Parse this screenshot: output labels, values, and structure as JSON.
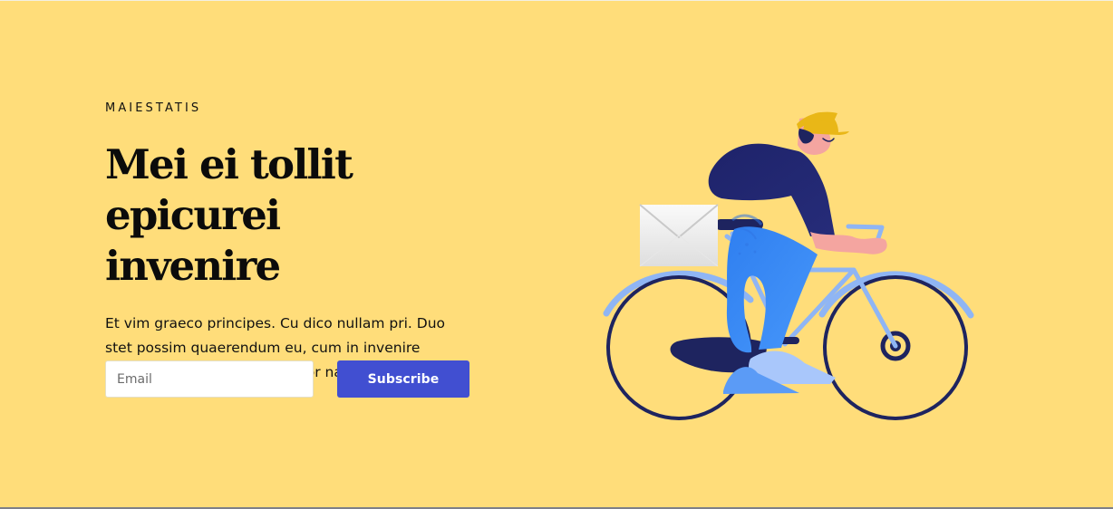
{
  "hero": {
    "eyebrow": "MAIESTATIS",
    "headline_line_1": "Mei ei tollit",
    "headline_line_2": "epicurei invenire",
    "description": "Et vim graeco principes. Cu dico nullam pri. Duo stet possim quaerendum eu, cum in invenire platonem. An animal assentior nam."
  },
  "subscribe_form": {
    "email_placeholder": "Email",
    "email_value": "",
    "button_label": "Subscribe"
  },
  "illustration": {
    "name": "courier-riding-bicycle-illustration",
    "icon_names": [
      "mail-envelope-icon",
      "bicycle-icon",
      "courier-person-icon"
    ]
  },
  "colors": {
    "background": "#FFDD7A",
    "button": "#414FD1",
    "bike_dark": "#1E245F",
    "bike_light": "#8FB5F4",
    "rider_blue": "#3E88F0",
    "rider_navy": "#242A70",
    "cap": "#E9B717",
    "skin": "#F4A5A0"
  }
}
